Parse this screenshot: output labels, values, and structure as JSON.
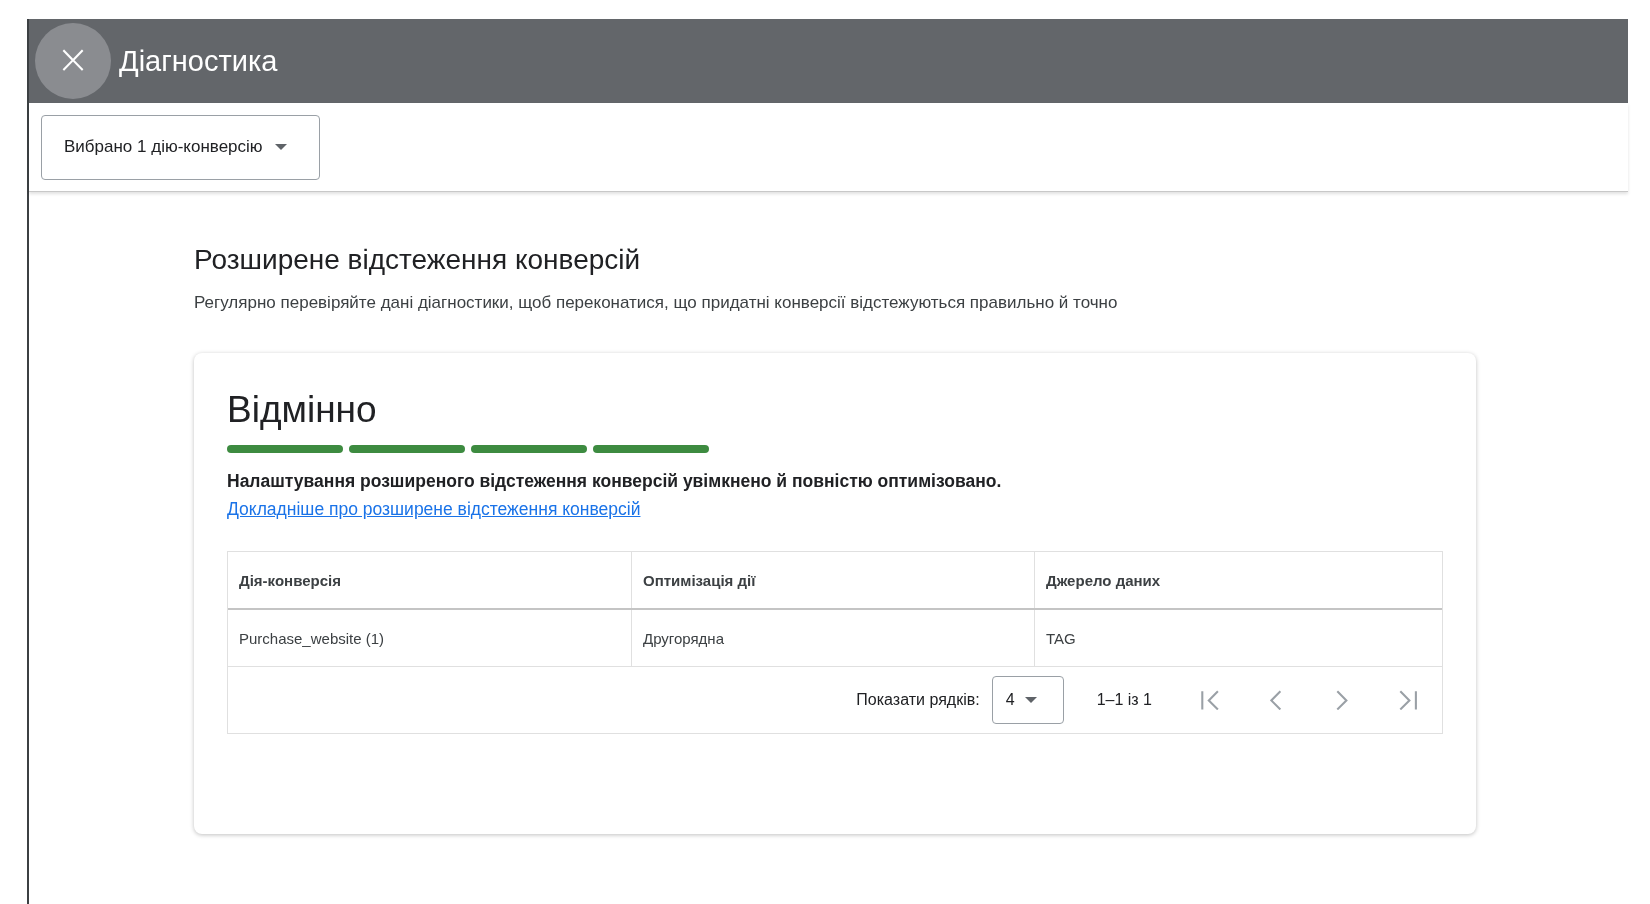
{
  "header": {
    "close_icon": "×",
    "title": "Діагностика"
  },
  "toolbar": {
    "dropdown": {
      "value": "Вибрано 1 дію-конверсію"
    }
  },
  "section": {
    "title": "Розширене відстеження конверсій",
    "subtitle": "Регулярно перевіряйте дані діагностики, щоб переконатися, що придатні конверсії відстежуються правильно й точно"
  },
  "card": {
    "status": "Відмінно",
    "segments": [
      {
        "filled": true
      },
      {
        "filled": true
      },
      {
        "filled": true
      },
      {
        "filled": true
      }
    ],
    "message": "Налаштування розширеного відстеження конверсій увімкнено й повністю оптимізовано.",
    "link": "Докладніше про розширене відстеження конверсій",
    "table": {
      "columns": [
        "Дія-конверсія",
        "Оптимізація дії",
        "Джерело даних"
      ],
      "rows": [
        [
          "Purchase_website (1)",
          "Другорядна",
          "TAG"
        ]
      ],
      "pagination": {
        "rows_label": "Показати рядків:",
        "rows_value": "4",
        "range": "1–1 із 1",
        "buttons": [
          {
            "kind": "first",
            "disabled": true
          },
          {
            "kind": "prev",
            "disabled": true
          },
          {
            "kind": "next",
            "disabled": true
          },
          {
            "kind": "last",
            "disabled": true
          }
        ]
      }
    }
  }
}
